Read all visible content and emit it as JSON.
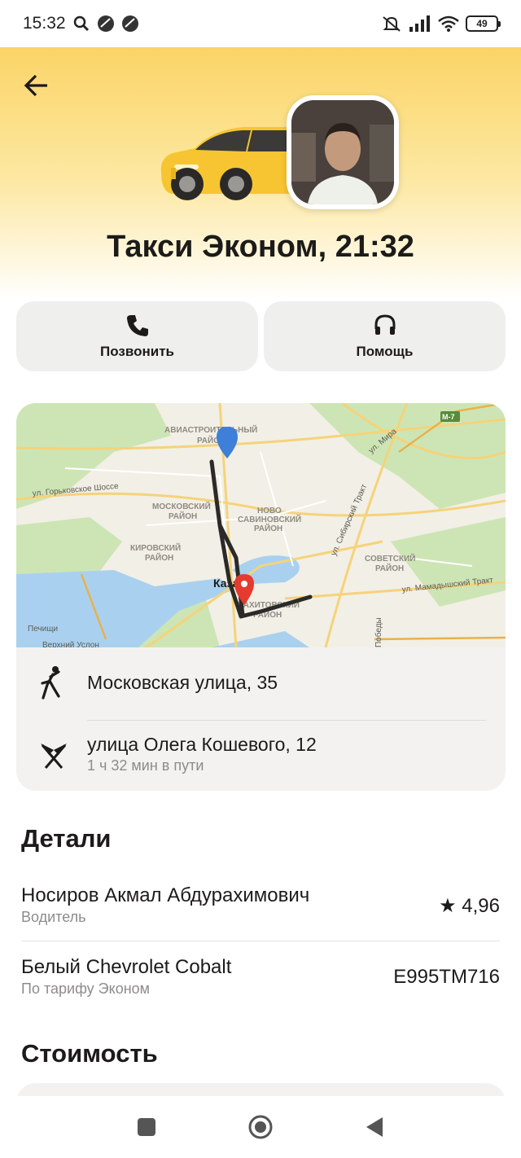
{
  "status_bar": {
    "time": "15:32",
    "battery": "49"
  },
  "header": {
    "title": "Такси Эконом, 21:32"
  },
  "actions": [
    {
      "label": "Позвонить",
      "icon": "phone-icon"
    },
    {
      "label": "Помощь",
      "icon": "headset-icon"
    }
  ],
  "map": {
    "labels": {
      "aviastroitelny": "АВИАСТРОИТЕЛЬНЫЙ",
      "district": "РАЙОН",
      "gorkovskoe": "ул. Горьковское Шоссе",
      "moskovsky": "МОСКОВСКИЙ",
      "novo": "НОВО",
      "savinovsky": "САВИНОВСКИЙ",
      "kirovsky": "КИРОВСКИЙ",
      "sovetsky": "СОВЕТСКИЙ",
      "kazan": "Казань",
      "vakhitovsky": "ВАХИТОВСКИЙ",
      "pechishchi": "Печищи",
      "verkhny_uslon": "Верхний Услон",
      "sibirsky": "ул. Сибирский Тракт",
      "mira": "ул. Мира",
      "mamadyshsky": "ул. Мамадышский Тракт",
      "pobedy": "Победы",
      "m7": "М-7"
    }
  },
  "route": {
    "from": "Московская улица, 35",
    "to": "улица Олега Кошевого, 12",
    "duration": "1 ч 32 мин в пути"
  },
  "details": {
    "title": "Детали",
    "driver_name": "Носиров Акмал Абдурахимович",
    "driver_role": "Водитель",
    "rating": "★ 4,96",
    "car": "Белый Chevrolet Cobalt",
    "tariff": "По тарифу Эконом",
    "plate": "Е995ТМ716"
  },
  "cost": {
    "title": "Стоимость"
  }
}
